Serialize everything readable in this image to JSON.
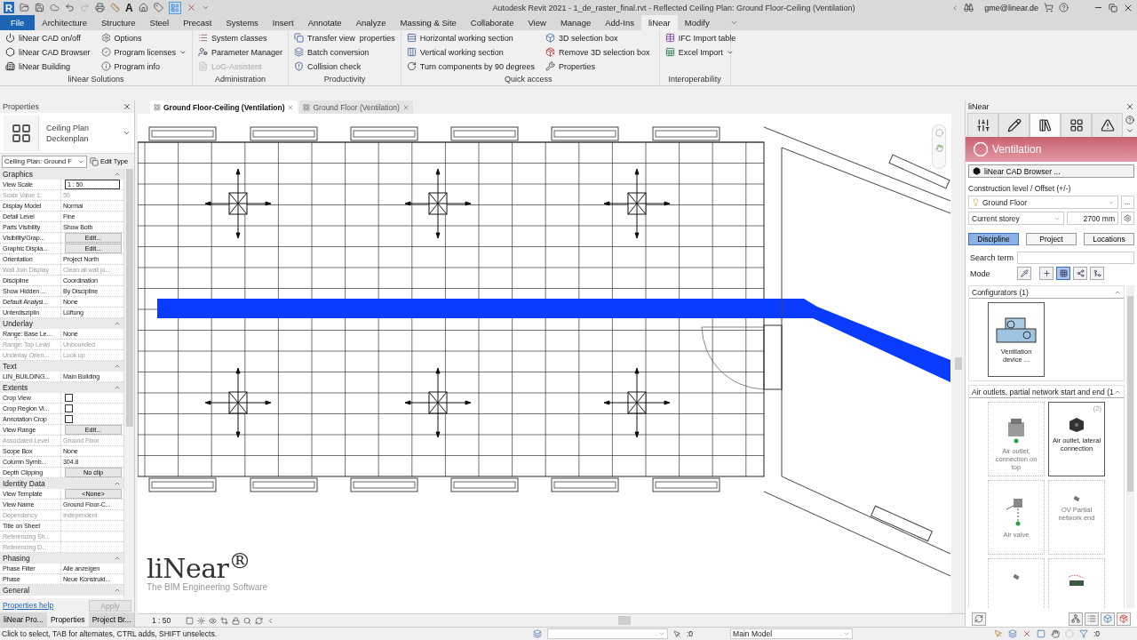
{
  "title_bar": {
    "app_logo": "R",
    "text_tool": "A",
    "title": "Autodesk Revit 2021 - 1_de_raster_final.rvt - Reflected Ceiling Plan: Ground Floor-Ceiling (Ventilation)",
    "user": "gme@linear.de"
  },
  "ribbon_tabs": [
    {
      "label": "File",
      "kind": "file",
      "selected": false
    },
    {
      "label": "Architecture",
      "kind": "tab",
      "selected": false
    },
    {
      "label": "Structure",
      "kind": "tab",
      "selected": false
    },
    {
      "label": "Steel",
      "kind": "tab",
      "selected": false
    },
    {
      "label": "Precast",
      "kind": "tab",
      "selected": false
    },
    {
      "label": "Systems",
      "kind": "tab",
      "selected": false
    },
    {
      "label": "Insert",
      "kind": "tab",
      "selected": false
    },
    {
      "label": "Annotate",
      "kind": "tab",
      "selected": false
    },
    {
      "label": "Analyze",
      "kind": "tab",
      "selected": false
    },
    {
      "label": "Massing & Site",
      "kind": "tab",
      "selected": false
    },
    {
      "label": "Collaborate",
      "kind": "tab",
      "selected": false
    },
    {
      "label": "View",
      "kind": "tab",
      "selected": false
    },
    {
      "label": "Manage",
      "kind": "tab",
      "selected": false
    },
    {
      "label": "Add-Ins",
      "kind": "tab",
      "selected": false
    },
    {
      "label": "liNear",
      "kind": "tab",
      "selected": true
    },
    {
      "label": "Modify",
      "kind": "tab",
      "selected": false
    }
  ],
  "ribbon_groups": [
    {
      "title": "liNear Solutions",
      "columns": [
        [
          {
            "label": "liNear CAD on/off",
            "disabled": false,
            "dropdown": false
          },
          {
            "label": "liNear CAD Browser",
            "disabled": false,
            "dropdown": false
          },
          {
            "label": "liNear Building",
            "disabled": false,
            "dropdown": false
          }
        ],
        [
          {
            "label": "Options",
            "disabled": false,
            "dropdown": false
          },
          {
            "label": "Program licenses",
            "disabled": false,
            "dropdown": true
          },
          {
            "label": "Program info",
            "disabled": false,
            "dropdown": false
          }
        ]
      ]
    },
    {
      "title": "Administration",
      "columns": [
        [
          {
            "label": "System classes",
            "disabled": false,
            "dropdown": false
          },
          {
            "label": "Parameter Manager",
            "disabled": false,
            "dropdown": false
          },
          {
            "label": "LoG-Assistent",
            "disabled": true,
            "dropdown": false
          }
        ]
      ]
    },
    {
      "title": "Productivity",
      "columns": [
        [
          {
            "label": "Transfer view  properties",
            "disabled": false,
            "dropdown": false
          },
          {
            "label": "Batch conversion",
            "disabled": false,
            "dropdown": false
          },
          {
            "label": "Collision check",
            "disabled": false,
            "dropdown": false
          }
        ]
      ]
    },
    {
      "title": "Quick access",
      "columns": [
        [
          {
            "label": "Horizontal working section",
            "disabled": false,
            "dropdown": false
          },
          {
            "label": "Vertical working section",
            "disabled": false,
            "dropdown": false
          },
          {
            "label": "Turn components by 90 degrees",
            "disabled": false,
            "dropdown": false
          }
        ],
        [
          {
            "label": "3D selection box",
            "disabled": false,
            "dropdown": false
          },
          {
            "label": "Remove 3D selection box",
            "disabled": false,
            "dropdown": false
          },
          {
            "label": "Properties",
            "disabled": false,
            "dropdown": false
          }
        ]
      ]
    },
    {
      "title": "Interoperability",
      "columns": [
        [
          {
            "label": "IFC Import table",
            "disabled": false,
            "dropdown": false
          },
          {
            "label": "Excel Import",
            "disabled": false,
            "dropdown": true
          }
        ]
      ]
    }
  ],
  "properties": {
    "title": "Properties",
    "type_name": "Ceiling Plan",
    "type_subname": "Deckenplan",
    "type_selector": "Ceiling Plan: Ground F",
    "edit_type": "Edit Type",
    "sections": [
      {
        "title": "Graphics",
        "rows": [
          {
            "name": "View Scale",
            "value": "1 : 50",
            "kind": "input",
            "disabled": false
          },
          {
            "name": "Scale Value 1:",
            "value": "50",
            "kind": "text",
            "disabled": true
          },
          {
            "name": "Display Model",
            "value": "Normal",
            "kind": "text",
            "disabled": false
          },
          {
            "name": "Detail Level",
            "value": "Fine",
            "kind": "text",
            "disabled": false
          },
          {
            "name": "Parts Visibility",
            "value": "Show Both",
            "kind": "text",
            "disabled": false
          },
          {
            "name": "Visibility/Grap...",
            "value": "Edit...",
            "kind": "button",
            "disabled": false
          },
          {
            "name": "Graphic Displa...",
            "value": "Edit...",
            "kind": "button",
            "disabled": false
          },
          {
            "name": "Orientation",
            "value": "Project North",
            "kind": "text",
            "disabled": false
          },
          {
            "name": "Wall Join Display",
            "value": "Clean all wall jo...",
            "kind": "text",
            "disabled": true
          },
          {
            "name": "Discipline",
            "value": "Coordination",
            "kind": "text",
            "disabled": false
          },
          {
            "name": "Show Hidden ...",
            "value": "By Discipline",
            "kind": "text",
            "disabled": false
          },
          {
            "name": "Default Analysi...",
            "value": "None",
            "kind": "text",
            "disabled": false
          },
          {
            "name": "Unterdisziplin",
            "value": "Lüftung",
            "kind": "text",
            "disabled": false
          }
        ]
      },
      {
        "title": "Underlay",
        "rows": [
          {
            "name": "Range: Base Le...",
            "value": "None",
            "kind": "text",
            "disabled": false
          },
          {
            "name": "Range: Top Level",
            "value": "Unbounded",
            "kind": "text",
            "disabled": true
          },
          {
            "name": "Underlay Orien...",
            "value": "Look up",
            "kind": "text",
            "disabled": true
          }
        ]
      },
      {
        "title": "Text",
        "rows": [
          {
            "name": "LIN_BUILDING...",
            "value": "Main Building",
            "kind": "text",
            "disabled": false
          }
        ]
      },
      {
        "title": "Extents",
        "rows": [
          {
            "name": "Crop View",
            "kind": "checkbox",
            "checked": false,
            "disabled": false
          },
          {
            "name": "Crop Region Vi...",
            "kind": "checkbox",
            "checked": false,
            "disabled": false
          },
          {
            "name": "Annotation Crop",
            "kind": "checkbox",
            "checked": false,
            "disabled": false
          },
          {
            "name": "View Range",
            "value": "Edit...",
            "kind": "button",
            "disabled": false
          },
          {
            "name": "Associated Level",
            "value": "Ground Floor",
            "kind": "text",
            "disabled": true
          },
          {
            "name": "Scope Box",
            "value": "None",
            "kind": "text",
            "disabled": false
          },
          {
            "name": "Column Symb...",
            "value": "304.8",
            "kind": "text",
            "disabled": false
          },
          {
            "name": "Depth Clipping",
            "value": "No clip",
            "kind": "button",
            "disabled": false
          }
        ]
      },
      {
        "title": "Identity Data",
        "rows": [
          {
            "name": "View Template",
            "value": "<None>",
            "kind": "button",
            "disabled": false
          },
          {
            "name": "View Name",
            "value": "Ground Floor-C...",
            "kind": "text",
            "disabled": false
          },
          {
            "name": "Dependency",
            "value": "Independent",
            "kind": "text",
            "disabled": true
          },
          {
            "name": "Title on Sheet",
            "kind": "text",
            "disabled": false
          },
          {
            "name": "Referencing Sh...",
            "kind": "text",
            "disabled": true
          },
          {
            "name": "Referencing D...",
            "kind": "text",
            "disabled": true
          }
        ]
      },
      {
        "title": "Phasing",
        "rows": [
          {
            "name": "Phase Filter",
            "value": "Alle anzeigen",
            "kind": "text",
            "disabled": false
          },
          {
            "name": "Phase",
            "value": "Neue Konstrukt...",
            "kind": "text",
            "disabled": false
          }
        ]
      },
      {
        "title": "General"
      }
    ],
    "help": "Properties help",
    "apply": "Apply"
  },
  "panel_tabs": [
    {
      "label": "liNear Pro...",
      "selected": false
    },
    {
      "label": "Properties",
      "selected": true
    },
    {
      "label": "Project Br...",
      "selected": false
    }
  ],
  "view_tabs": [
    {
      "label": "Ground Floor-Ceiling (Ventilation)",
      "selected": true
    },
    {
      "label": "Ground Floor (Ventilation)",
      "selected": false
    }
  ],
  "canvas": {
    "logo": "liNear$^{®}$",
    "tagline": "The BIM Engineering Software",
    "scale": "1 : 50"
  },
  "linear_panel": {
    "title": "liNear",
    "tabs": [
      {
        "kind": "sliders",
        "selected": false
      },
      {
        "kind": "pencil",
        "selected": false
      },
      {
        "kind": "library",
        "selected": true
      },
      {
        "kind": "grid",
        "selected": false
      },
      {
        "kind": "warning",
        "selected": false
      }
    ],
    "discipline": "Ventilation",
    "browser_button": "liNear CAD Browser ...",
    "level_label": "Construction level / Offset (+/-)",
    "level": "Ground Floor",
    "more": "...",
    "storey": "Current storey",
    "offset": "2700 mm",
    "filter_tabs": [
      {
        "label": "Discipline",
        "selected": true
      },
      {
        "label": "Project",
        "selected": false
      },
      {
        "label": "Locations",
        "selected": false
      }
    ],
    "search_label": "Search term",
    "mode_label": "Mode",
    "mode_buttons": [
      {
        "selected": false
      },
      {
        "selected": false
      },
      {
        "selected": true
      },
      {
        "selected": false
      },
      {
        "selected": false
      }
    ],
    "groups": [
      {
        "title": "Configurators (1)",
        "items": [
          {
            "kind": "unit",
            "label": "Ventilation device ...",
            "selected": true
          }
        ]
      },
      {
        "title": "Air outlets, partial network start and end (1",
        "items": [
          {
            "kind": "outlet-top",
            "label": "Air outlet, connection on top",
            "selected": false
          },
          {
            "kind": "outlet-side",
            "label": "Air outlet, lateral connection",
            "count": "(2)",
            "selected": true
          },
          {
            "kind": "valve",
            "label": "Air valve",
            "selected": false
          },
          {
            "kind": "end",
            "label": "OV Partial network end",
            "selected": false
          },
          {
            "kind": "end",
            "selected": false
          },
          {
            "kind": "bend",
            "selected": false
          }
        ]
      }
    ]
  },
  "status_bar": {
    "message": "Click to select, TAB for alternates, CTRL adds, SHIFT unselects.",
    "workset_count": ":0",
    "model": "Main Model",
    "filter_count": ":0"
  }
}
